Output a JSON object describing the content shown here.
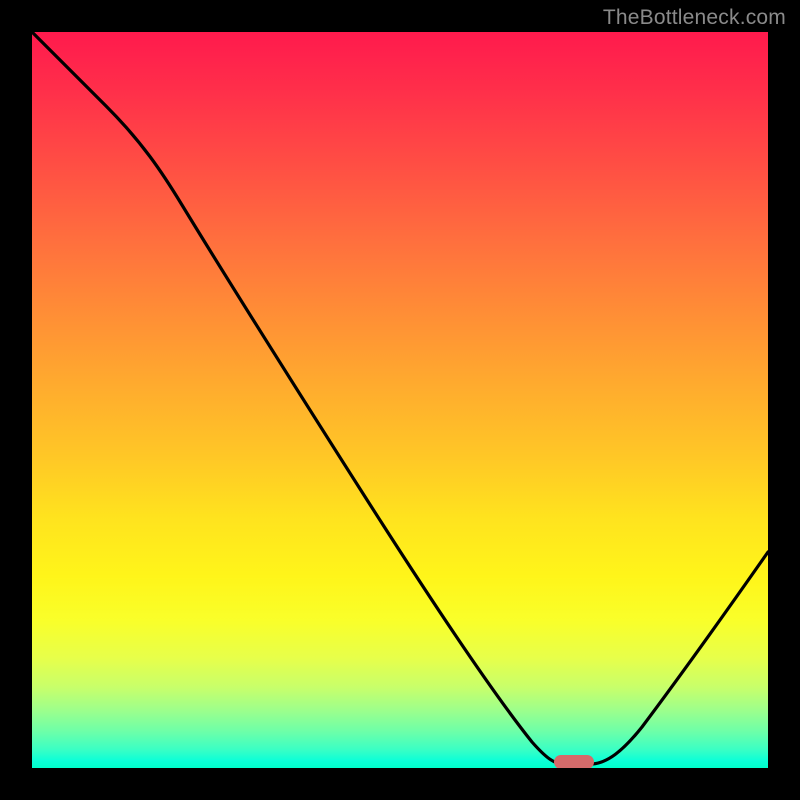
{
  "watermark": {
    "text": "TheBottleneck.com"
  },
  "chart_data": {
    "type": "line",
    "title": "",
    "xlabel": "",
    "ylabel": "",
    "xlim": [
      0,
      100
    ],
    "ylim": [
      0,
      100
    ],
    "grid": false,
    "legend": false,
    "background_gradient": {
      "top_color": "#ff1a4d",
      "bottom_color": "#00ffcc",
      "note": "vertical gradient red→orange→yellow→green representing bottleneck severity (high at top, low at bottom)"
    },
    "series": [
      {
        "name": "bottleneck-curve",
        "x": [
          0,
          10,
          18,
          26,
          34,
          42,
          50,
          58,
          64,
          68,
          71,
          74,
          80,
          86,
          92,
          100
        ],
        "y": [
          100,
          90,
          82,
          73,
          63,
          52,
          41,
          30,
          20,
          10,
          3,
          1,
          2,
          8,
          17,
          30
        ]
      }
    ],
    "marker": {
      "name": "optimal-point",
      "x": 73,
      "y": 1,
      "color": "#d46a6a"
    }
  }
}
